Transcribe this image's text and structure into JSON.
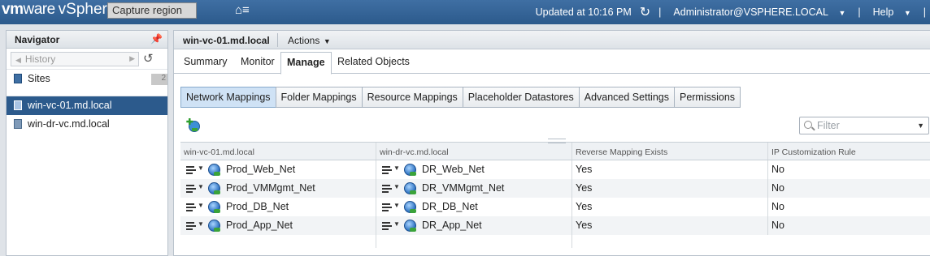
{
  "header": {
    "brand_vm": "vm",
    "brand_ware": "ware",
    "brand_rest": "vSphere Web Client",
    "capture_overlay": "Capture region",
    "updated": "Updated at 10:16 PM",
    "user": "Administrator@VSPHERE.LOCAL",
    "help": "Help"
  },
  "navigator": {
    "title": "Navigator",
    "history_placeholder": "History",
    "items": [
      {
        "label": "Sites",
        "badge": "2"
      },
      {
        "label": "win-vc-01.md.local",
        "selected": true
      },
      {
        "label": "win-dr-vc.md.local"
      }
    ]
  },
  "main": {
    "title": "win-vc-01.md.local",
    "actions_label": "Actions",
    "tabs": [
      "Summary",
      "Monitor",
      "Manage",
      "Related Objects"
    ],
    "active_tab": "Manage",
    "subtabs": [
      "Network Mappings",
      "Folder Mappings",
      "Resource Mappings",
      "Placeholder Datastores",
      "Advanced Settings",
      "Permissions"
    ],
    "active_subtab": "Network Mappings",
    "filter_placeholder": "Filter"
  },
  "grid": {
    "columns": [
      "win-vc-01.md.local",
      "win-dr-vc.md.local",
      "Reverse Mapping Exists",
      "IP Customization Rule"
    ],
    "rows": [
      {
        "source": "Prod_Web_Net",
        "target": "DR_Web_Net",
        "reverse": "Yes",
        "ip_rule": "No"
      },
      {
        "source": "Prod_VMMgmt_Net",
        "target": "DR_VMMgmt_Net",
        "reverse": "Yes",
        "ip_rule": "No"
      },
      {
        "source": "Prod_DB_Net",
        "target": "DR_DB_Net",
        "reverse": "Yes",
        "ip_rule": "No"
      },
      {
        "source": "Prod_App_Net",
        "target": "DR_App_Net",
        "reverse": "Yes",
        "ip_rule": "No"
      }
    ]
  },
  "colors": {
    "header_blue": "#2c5a8c",
    "selected_row": "#2c5a8c",
    "active_subtab": "#cfe2f5"
  }
}
